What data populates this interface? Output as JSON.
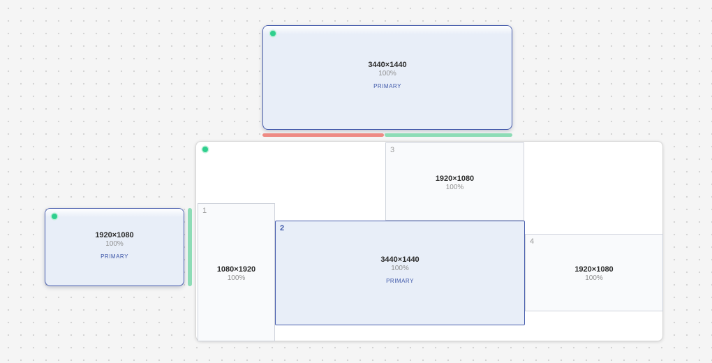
{
  "accent": "#4a5fae",
  "status_ok": "#2fcf8e",
  "status_warn": "#ee8a84",
  "floating_top": {
    "resolution": "3440×1440",
    "scale": "100%",
    "badge": "PRIMARY"
  },
  "floating_left": {
    "resolution": "1920×1080",
    "scale": "100%",
    "badge": "PRIMARY"
  },
  "layout": {
    "monitors": [
      {
        "number": "1",
        "resolution": "1080×1920",
        "scale": "100%"
      },
      {
        "number": "2",
        "resolution": "3440×1440",
        "scale": "100%",
        "badge": "PRIMARY"
      },
      {
        "number": "3",
        "resolution": "1920×1080",
        "scale": "100%"
      },
      {
        "number": "4",
        "resolution": "1920×1080",
        "scale": "100%"
      }
    ]
  }
}
